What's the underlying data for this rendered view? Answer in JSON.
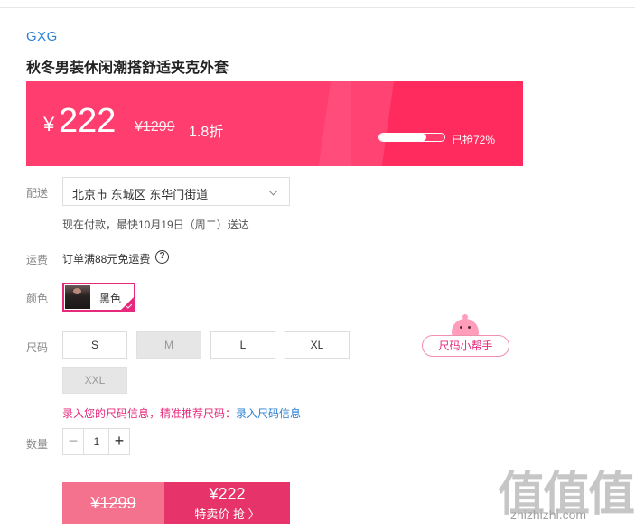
{
  "brand": "GXG",
  "title": "秋冬男装休闲潮搭舒适夹克外套",
  "price": {
    "currency": "¥",
    "current": "222",
    "original": "¥1299",
    "discount": "1.8折",
    "sold_percent": 72,
    "sold_text": "已抢72%"
  },
  "delivery": {
    "label": "配送",
    "address": "北京市 东城区 东华门街道",
    "eta": "现在付款，最快10月19日（周二）送达"
  },
  "shipping": {
    "label": "运费",
    "text": "订单满88元免运费",
    "help_icon": "?"
  },
  "color": {
    "label": "颜色",
    "selected": "黑色"
  },
  "size": {
    "label": "尺码",
    "options": [
      {
        "label": "S",
        "available": true
      },
      {
        "label": "M",
        "available": false
      },
      {
        "label": "L",
        "available": true
      },
      {
        "label": "XL",
        "available": true
      },
      {
        "label": "XXL",
        "available": false
      }
    ],
    "helper": "尺码小帮手",
    "note_prefix": "录入您的尺码信息，精准推荐尺码：",
    "note_link": "录入尺码信息"
  },
  "quantity": {
    "label": "数量",
    "minus": "−",
    "value": "1",
    "plus": "+"
  },
  "buttons": {
    "original_price": "¥1299",
    "sale_price": "¥222",
    "sale_label": "特卖价 抢 〉"
  },
  "watermark": {
    "text": "值值值",
    "url": "zhizhizhi.com"
  },
  "colors": {
    "accent": "#e6297b",
    "banner": "#ff3b6b",
    "link": "#2b7fd3"
  }
}
